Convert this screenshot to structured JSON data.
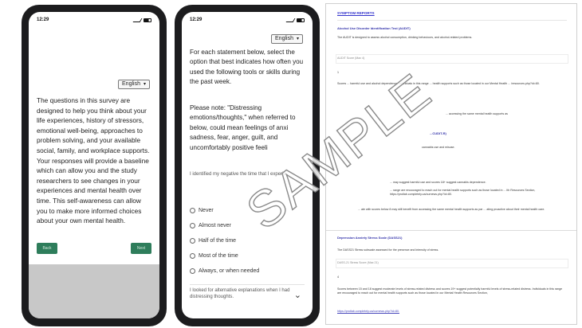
{
  "watermark": "SAMPLE",
  "phone1": {
    "time": "12:29",
    "language": "English",
    "intro": "The questions in this survey are designed to help you think about your life experiences, history of stressors, emotional well-being, approaches to problem solving, and your available social, family, and workplace supports. Your responses will provide a baseline which can allow you and the study researchers to see changes in your experiences and mental health over time. This self-awareness can allow you to make more informed choices about your own mental health.",
    "back_label": "Back",
    "next_label": "Next"
  },
  "phone2": {
    "time": "12:29",
    "language": "English",
    "instructions": "For each statement below, select the option that best indicates how often you used the following tools or skills during the past week.",
    "note": "Please note: \"Distressing emotions/thoughts,\" when referred to below, could mean feelings of anxi sadness, fear, anger, guilt, and uncomfortably positive feeli",
    "question": "I identified my negative the time that I experie",
    "options": [
      "Never",
      "Almost never",
      "Half of the time",
      "Most of the time",
      "Always, or when needed"
    ],
    "next_question": "I looked for alternative explanations when I had distressing thoughts."
  },
  "report": {
    "title": "SYMPTOM REPORTS",
    "audit_heading": "Alcohol Use Disorder Identification Test (AUDIT)",
    "audit_desc": "The AUDIT is designed to assess alcohol consumption, drinking behaviours, and alcohol-related problems.",
    "audit_score_label": "AUDIT Score (Max 4)",
    "audit_score": "1",
    "audit_interp": "Scores ... harmful use and alcohol dependence. Individuals in this range ... health supports such as those located in our Mental Health ... /resources.php?id=80.",
    "audit_extra": "... accessing the same mental health supports as",
    "cudit_heading": "...CUDIT-R)",
    "cudit_desc": "cannabis use and misuse.",
    "cudit_interp_1": "... may suggest harmful use and scores 18+ suggest cannabis dependence.",
    "cudit_interp_2": "... range are encouraged to reach out for mental health supports such as those located in ... lth Resources Section, https://protlab.completely.ca/ournews.php?id=80.",
    "cudit_interp_3": "... ate with scores below 8 may still benefit from accessing the same mental health supports as par ... ating proactive about their mental health care.",
    "dass_heading": "Depression Anxiety Stress Scale (DASS21)",
    "dass_desc": "The DASS21 Stress subscale assessed for the presence and intensity of stress.",
    "dass_score_label": "DASS-21 Stress Score (Max 21)",
    "dass_score": "4",
    "dass_interp": "Scores between 15 and 18 suggest moderate levels of stress-related distress and scores 19+ suggest potentially harmful levels of stress-related distress. Individuals in this range are encouraged to reach out for mental health supports such as those located in our Mental Health Resources Section,",
    "dass_link": "https://protlab.completely.ca/ournews.php?id=80."
  }
}
